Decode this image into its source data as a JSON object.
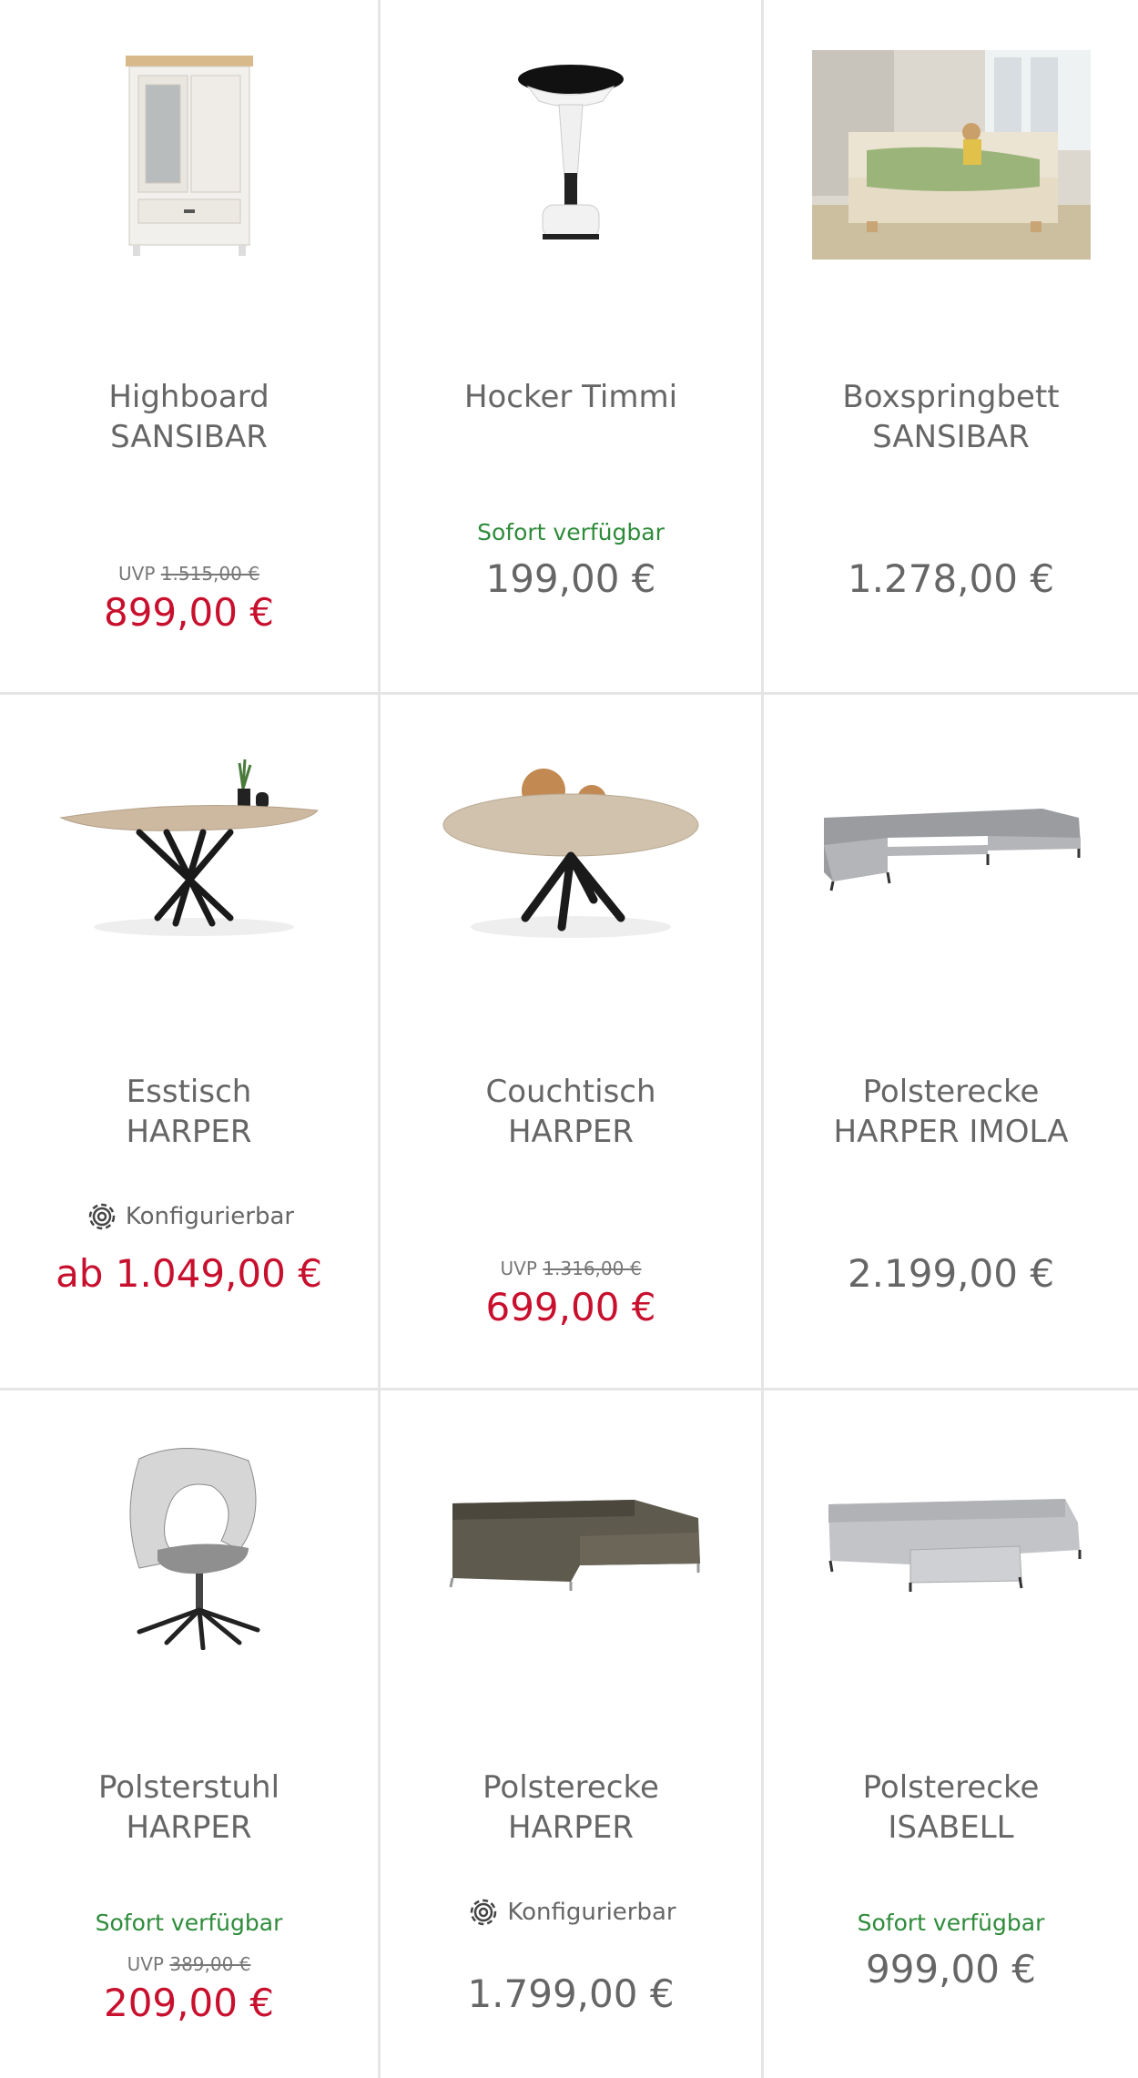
{
  "products": [
    {
      "name1": "Highboard",
      "name2": "SANSIBAR",
      "uvp_label": "UVP",
      "uvp": "1.515,00 €",
      "price": "899,00 €"
    },
    {
      "name1": "Hocker Timmi",
      "name2": "",
      "availability": "Sofort verfügbar",
      "price": "199,00 €"
    },
    {
      "name1": "Boxspringbett",
      "name2": "SANSIBAR",
      "price": "1.278,00 €"
    },
    {
      "name1": "Esstisch",
      "name2": "HARPER",
      "config": "Konfigurierbar",
      "price": "ab 1.049,00 €"
    },
    {
      "name1": "Couchtisch",
      "name2": "HARPER",
      "uvp_label": "UVP",
      "uvp": "1.316,00 €",
      "price": "699,00 €"
    },
    {
      "name1": "Polsterecke",
      "name2": "HARPER IMOLA",
      "price": "2.199,00 €"
    },
    {
      "name1": "Polsterstuhl",
      "name2": "HARPER",
      "availability": "Sofort verfügbar",
      "uvp_label": "UVP",
      "uvp": "389,00 €",
      "price": "209,00 €"
    },
    {
      "name1": "Polsterecke",
      "name2": "HARPER",
      "config": "Konfigurierbar",
      "price": "1.799,00 €"
    },
    {
      "name1": "Polsterecke",
      "name2": "ISABELL",
      "availability": "Sofort verfügbar",
      "price": "999,00 €"
    }
  ],
  "colors": {
    "sale": "#c8102e",
    "available": "#2e8b3a",
    "text": "#666666",
    "divider": "#e5e5e5"
  },
  "icons": {
    "config": "gear-icon"
  }
}
